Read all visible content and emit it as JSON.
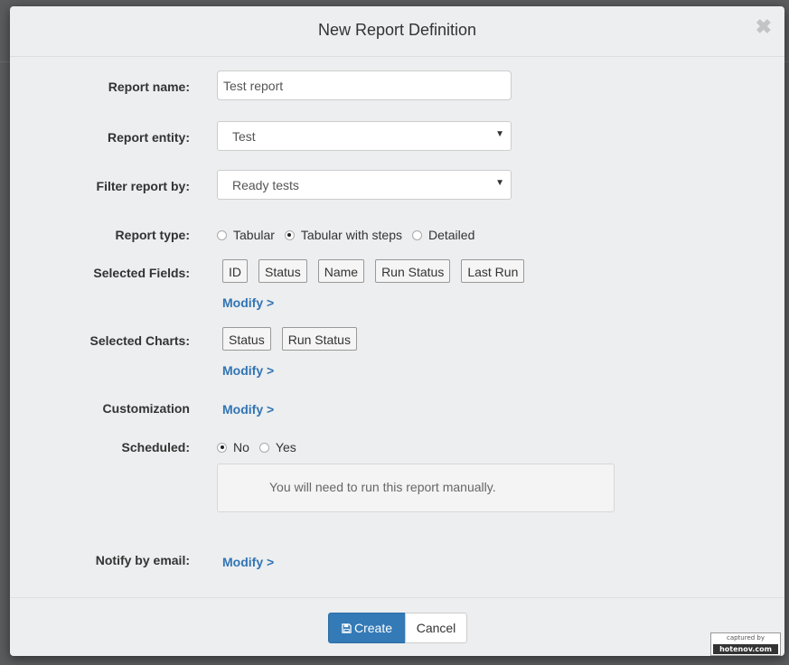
{
  "modal": {
    "title": "New Report Definition",
    "close_glyph": "✖"
  },
  "form": {
    "report_name": {
      "label": "Report name:",
      "value": "Test report"
    },
    "report_entity": {
      "label": "Report entity:",
      "value": "Test"
    },
    "filter": {
      "label": "Filter report by:",
      "value": "Ready tests"
    },
    "report_type": {
      "label": "Report type:",
      "options": [
        "Tabular",
        "Tabular with steps",
        "Detailed"
      ],
      "selected": "Tabular with steps"
    },
    "selected_fields": {
      "label": "Selected Fields:",
      "tags": [
        "ID",
        "Status",
        "Name",
        "Run Status",
        "Last Run"
      ],
      "modify": "Modify >"
    },
    "selected_charts": {
      "label": "Selected Charts:",
      "tags": [
        "Status",
        "Run Status"
      ],
      "modify": "Modify >"
    },
    "customization": {
      "label": "Customization",
      "modify": "Modify >"
    },
    "scheduled": {
      "label": "Scheduled:",
      "options": [
        "No",
        "Yes"
      ],
      "selected": "No",
      "info": "You will need to run this report manually."
    },
    "notify": {
      "label": "Notify by email:",
      "modify": "Modify >"
    }
  },
  "footer": {
    "create_label": "Create",
    "cancel_label": "Cancel"
  },
  "watermark": {
    "line1": "captured by",
    "line2": "hotenov.com"
  },
  "colors": {
    "primary": "#337ab7",
    "link": "#3174b5",
    "modal_bg": "#eceeef"
  }
}
